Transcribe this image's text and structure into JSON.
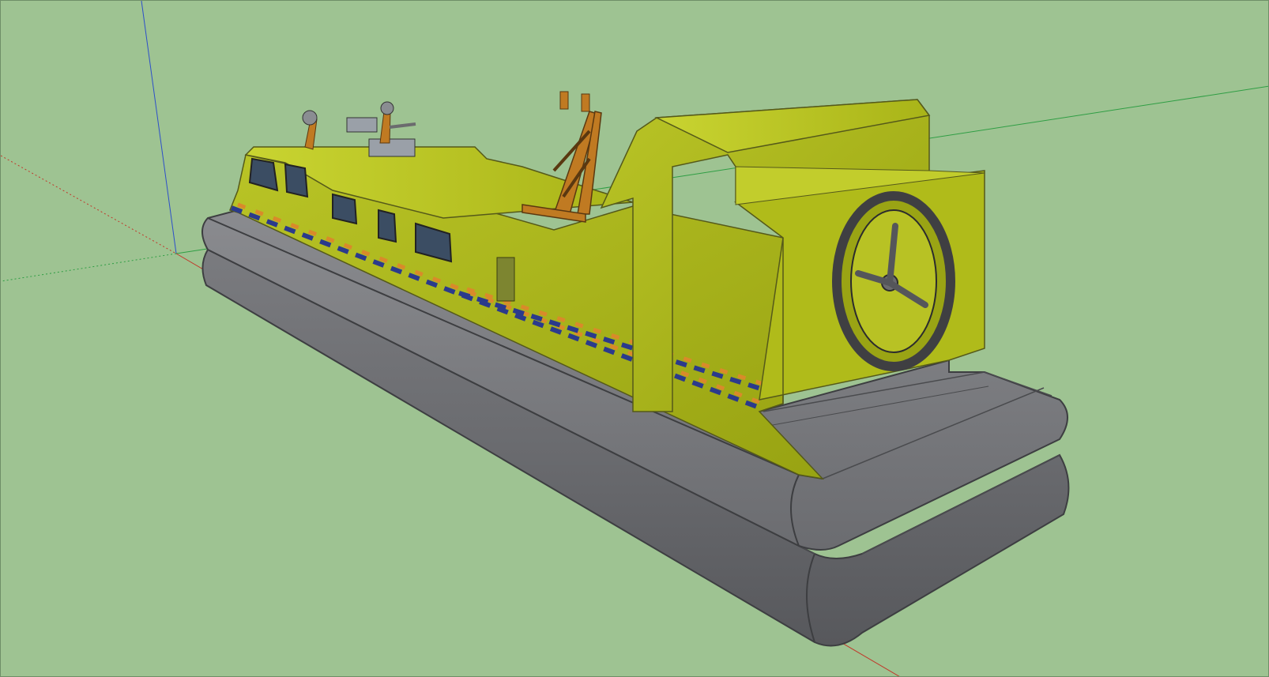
{
  "viewport": {
    "background_color": "#9ec392",
    "axis_colors": {
      "red": "#c0392b",
      "green": "#2f9e44",
      "blue": "#1f3fbf"
    }
  },
  "model": {
    "subject": "hovercraft",
    "hull_color": "#b6c21f",
    "skirt_color": "#6c6d70",
    "trim_colors": [
      "#2b3a8c",
      "#d98a2a"
    ],
    "mast_color": "#c07a22"
  }
}
